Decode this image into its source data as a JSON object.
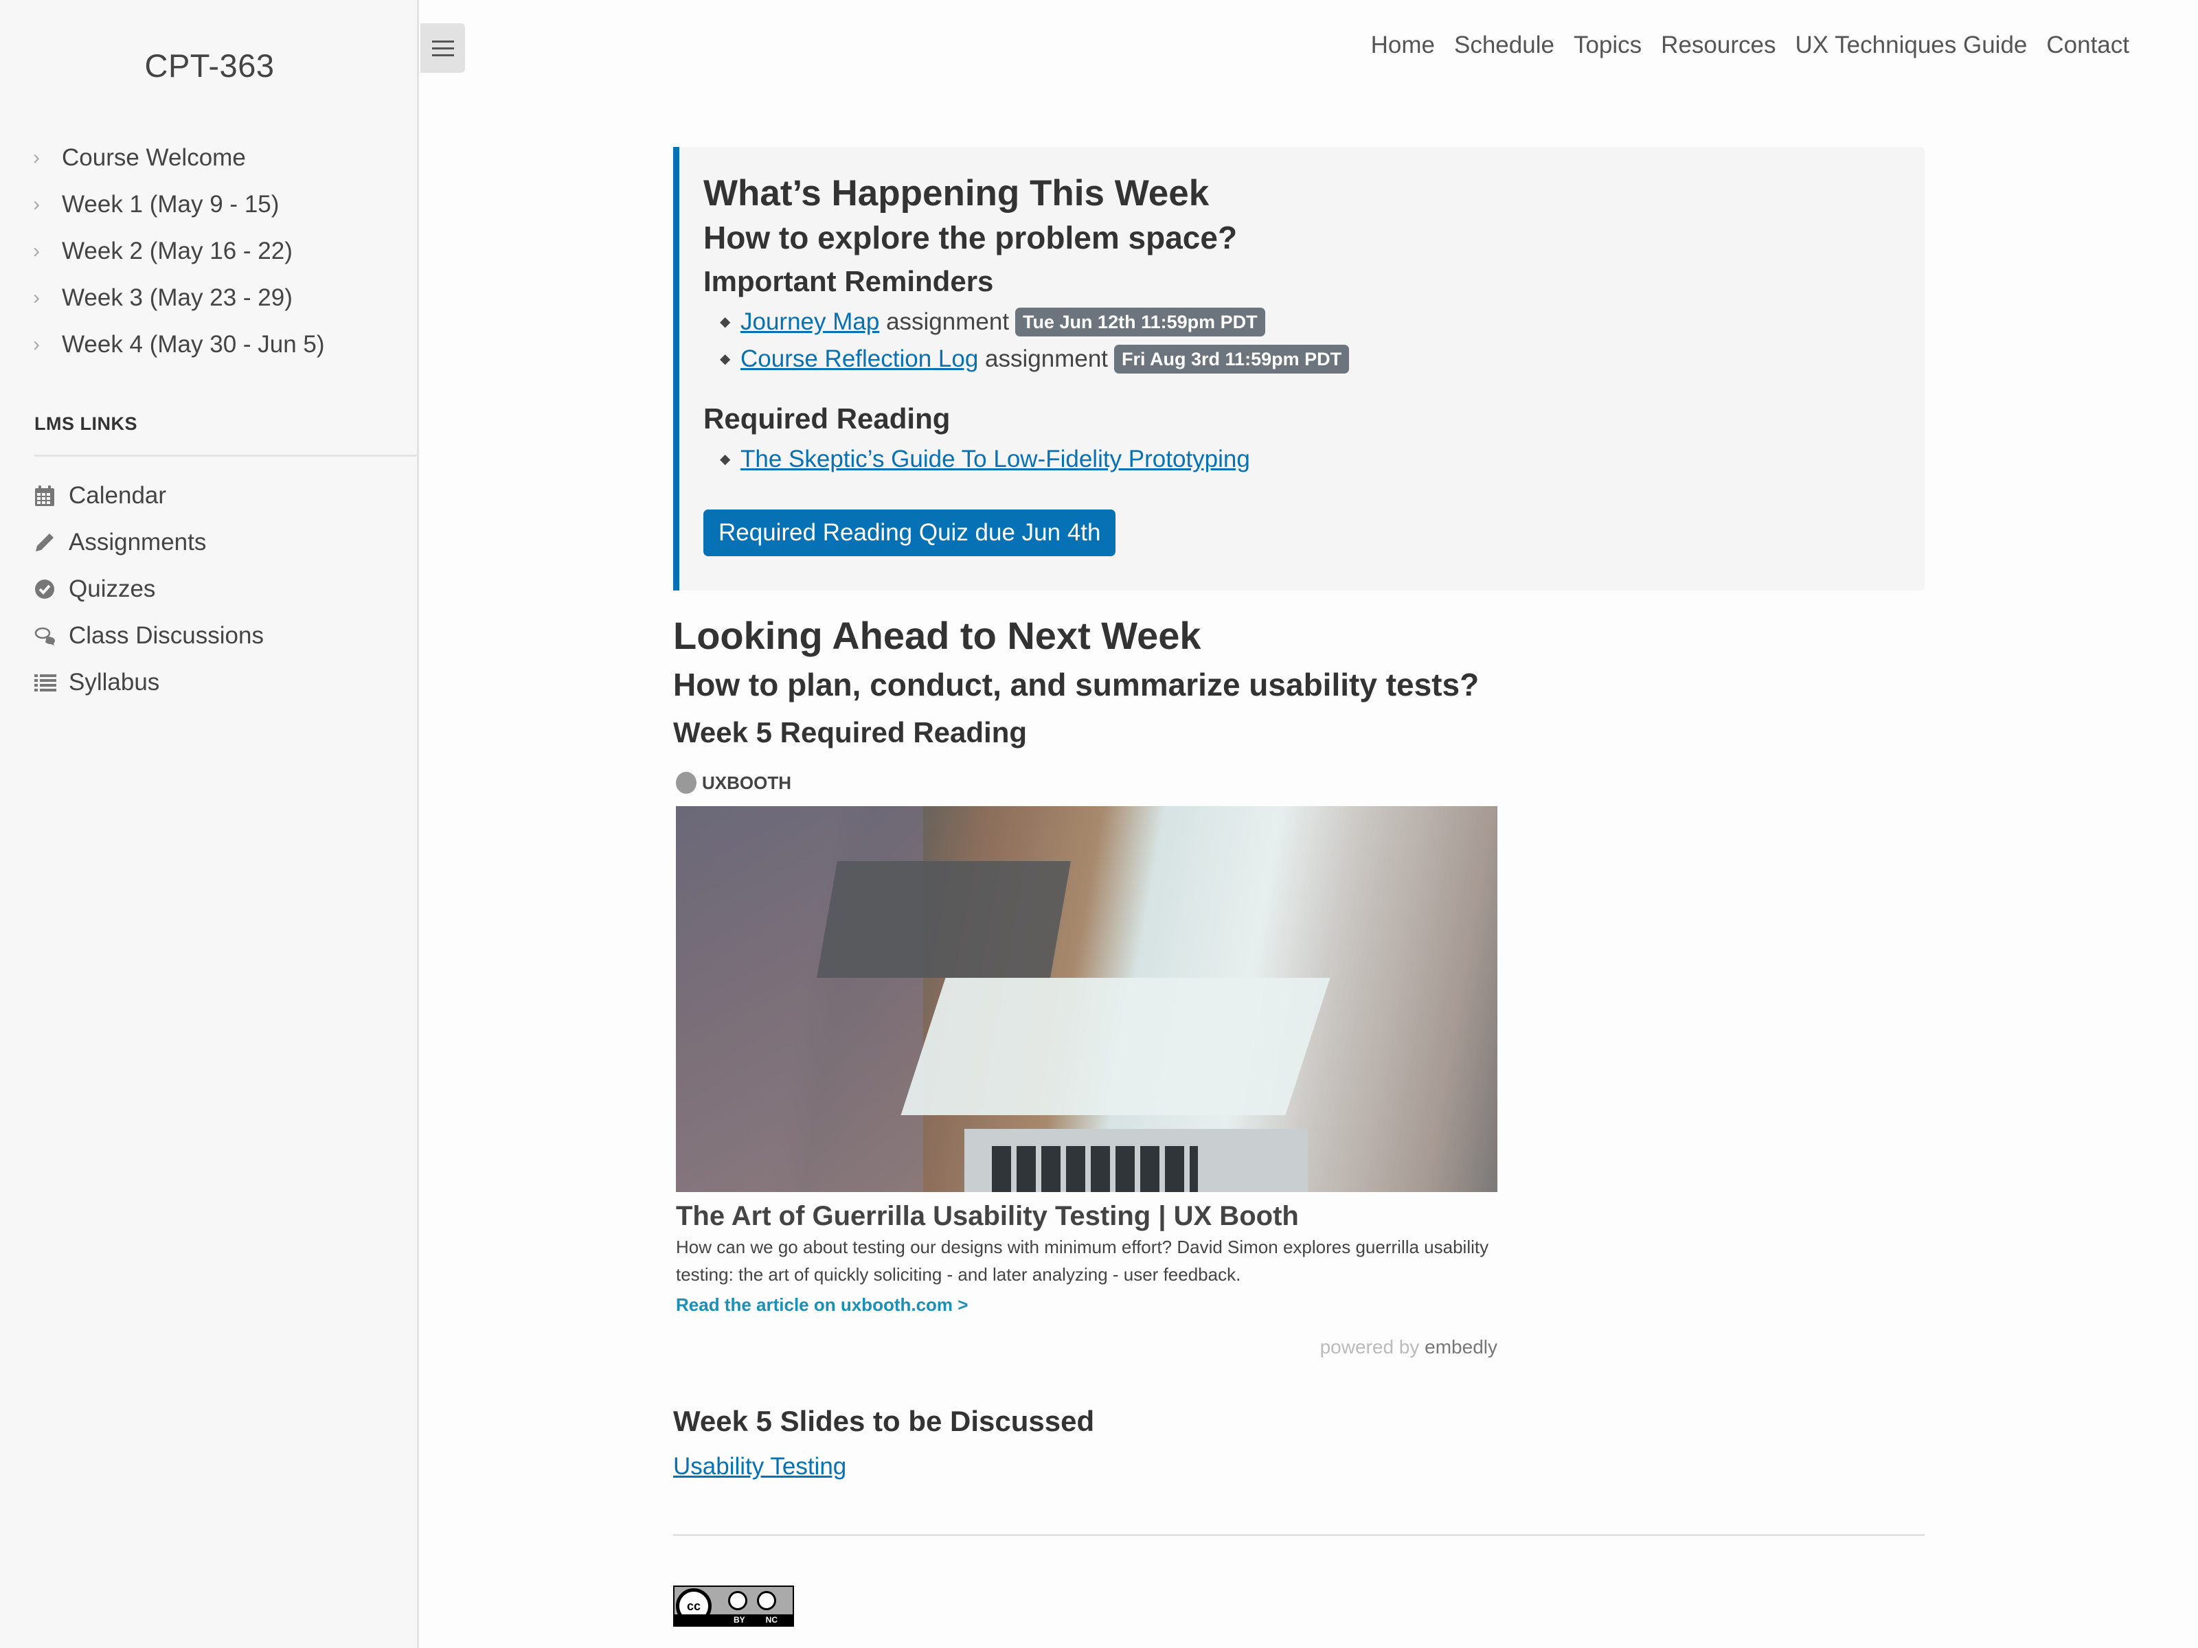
{
  "sidebar": {
    "course_title": "CPT-363",
    "weeks": [
      {
        "label": "Course Welcome"
      },
      {
        "label": "Week 1 (May 9 - 15)"
      },
      {
        "label": "Week 2 (May 16 - 22)"
      },
      {
        "label": "Week 3 (May 23 - 29)"
      },
      {
        "label": "Week 4 (May 30 - Jun 5)"
      }
    ],
    "lms_heading": "LMS LINKS",
    "lms_links": [
      {
        "label": "Calendar",
        "icon": "calendar-icon"
      },
      {
        "label": "Assignments",
        "icon": "pencil-icon"
      },
      {
        "label": "Quizzes",
        "icon": "check-circle-icon"
      },
      {
        "label": "Class Discussions",
        "icon": "comments-icon"
      },
      {
        "label": "Syllabus",
        "icon": "list-icon"
      }
    ]
  },
  "topnav": {
    "items": [
      "Home",
      "Schedule",
      "Topics",
      "Resources",
      "UX Techniques Guide",
      "Contact"
    ]
  },
  "this_week": {
    "title": "What’s Happening This Week",
    "question": "How to explore the problem space?",
    "reminders_heading": "Important Reminders",
    "reminders": [
      {
        "link": "Journey Map",
        "suffix": "assignment",
        "due": "Tue Jun 12th 11:59pm PDT"
      },
      {
        "link": "Course Reflection Log",
        "suffix": "assignment",
        "due": "Fri Aug 3rd 11:59pm PDT"
      }
    ],
    "reading_heading": "Required Reading",
    "readings": [
      {
        "link": "The Skeptic’s Guide To Low-Fidelity Prototyping"
      }
    ],
    "quiz_button": "Required Reading Quiz due Jun 4th"
  },
  "next_week": {
    "title": "Looking Ahead to Next Week",
    "question": "How to plan, conduct, and summarize usability tests?",
    "reading_heading": "Week 5 Required Reading",
    "embed": {
      "source": "UXBOOTH",
      "title": "The Art of Guerrilla Usability Testing | UX Booth",
      "description": "How can we go about testing our designs with minimum effort? David Simon explores guerrilla usability testing: the art of quickly soliciting - and later analyzing - user feedback.",
      "link": "Read the article on uxbooth.com >",
      "powered_by": "powered by",
      "powered_brand": "embedly"
    },
    "slides_heading": "Week 5 Slides to be Discussed",
    "slides_link": "Usability Testing"
  },
  "footer": {
    "license_by": "BY",
    "license_nc": "NC",
    "license_cc": "cc"
  },
  "colors": {
    "accent": "#0672b5",
    "badge": "#6c757d",
    "sidebar_bg": "#f7f7f7",
    "callout_bg": "#f5f5f5",
    "embed_link": "#1a8fb8"
  }
}
